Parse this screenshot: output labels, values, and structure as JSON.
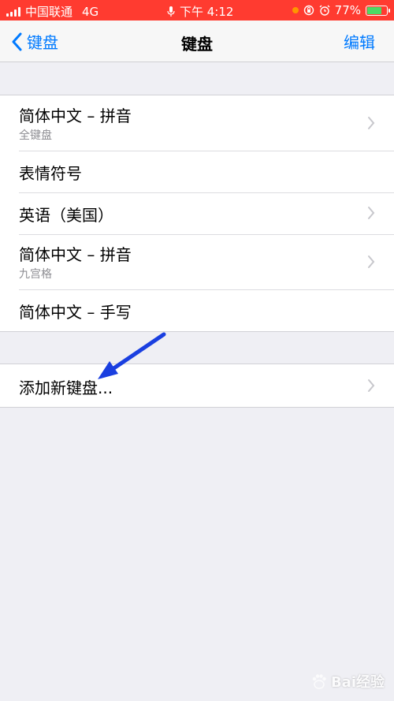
{
  "status_bar": {
    "carrier": "中国联通",
    "network": "4G",
    "time": "下午 4:12",
    "battery": "77%",
    "battery_level": 0.77,
    "background_color": "#ff3b30"
  },
  "nav": {
    "back_label": "键盘",
    "title": "键盘",
    "edit_label": "编辑",
    "accent_color": "#007aff"
  },
  "keyboards": [
    {
      "title": "简体中文 – 拼音",
      "subtitle": "全键盘",
      "has_chevron": true
    },
    {
      "title": "表情符号",
      "subtitle": "",
      "has_chevron": false
    },
    {
      "title": "英语（美国）",
      "subtitle": "",
      "has_chevron": true
    },
    {
      "title": "简体中文 – 拼音",
      "subtitle": "九宫格",
      "has_chevron": true
    },
    {
      "title": "简体中文 – 手写",
      "subtitle": "",
      "has_chevron": false
    }
  ],
  "add_keyboard": {
    "label": "添加新键盘...",
    "has_chevron": true
  },
  "annotation": {
    "arrow_color": "#1a3fe0",
    "arrow_icon": "arrow-pointer-icon"
  },
  "watermark": {
    "icon": "baidu-paw-icon",
    "text": "Bai经验"
  }
}
